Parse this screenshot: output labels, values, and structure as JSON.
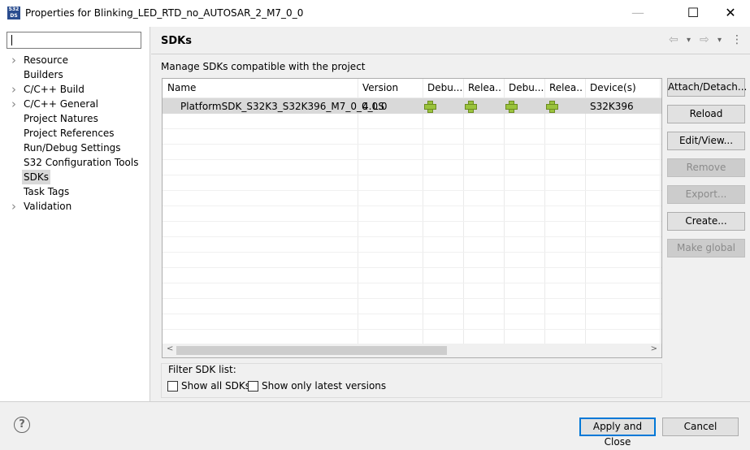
{
  "window": {
    "title": "Properties for Blinking_LED_RTD_no_AUTOSAR_2_M7_0_0",
    "icon_text": "S32 DS",
    "minimize": "—",
    "maximize": "☐",
    "close": "✕"
  },
  "sidebar": {
    "filter_value": "",
    "items": [
      {
        "label": "Resource",
        "expandable": true
      },
      {
        "label": "Builders",
        "expandable": false
      },
      {
        "label": "C/C++ Build",
        "expandable": true
      },
      {
        "label": "C/C++ General",
        "expandable": true
      },
      {
        "label": "Project Natures",
        "expandable": false
      },
      {
        "label": "Project References",
        "expandable": false
      },
      {
        "label": "Run/Debug Settings",
        "expandable": false
      },
      {
        "label": "S32 Configuration Tools",
        "expandable": false
      },
      {
        "label": "SDKs",
        "expandable": false,
        "selected": true
      },
      {
        "label": "Task Tags",
        "expandable": false
      },
      {
        "label": "Validation",
        "expandable": true
      }
    ]
  },
  "header": {
    "title": "SDKs",
    "back_icon": "⇦",
    "fwd_icon": "⇨",
    "dropdown": "▾",
    "menu": "⋮"
  },
  "main": {
    "description": "Manage SDKs compatible with the project",
    "columns": [
      "Name",
      "Version",
      "Debu...",
      "Relea...",
      "Debu...",
      "Relea...",
      "Device(s)"
    ],
    "rows": [
      {
        "name": "PlatformSDK_S32K3_S32K396_M7_0_0_LS",
        "version": "4.0.0",
        "debug1": true,
        "release1": true,
        "debug2": true,
        "release2": true,
        "devices": "S32K396"
      }
    ],
    "buttons": [
      {
        "label": "Attach/Detach...",
        "enabled": true
      },
      {
        "label": "Reload",
        "enabled": true
      },
      {
        "label": "Edit/View...",
        "enabled": true
      },
      {
        "label": "Remove",
        "enabled": false
      },
      {
        "label": "Export...",
        "enabled": false
      },
      {
        "label": "Create...",
        "enabled": true
      },
      {
        "label": "Make global",
        "enabled": false
      }
    ],
    "filter": {
      "label": "Filter SDK list:",
      "show_all": "Show all SDKs",
      "show_latest": "Show only latest versions"
    }
  },
  "footer": {
    "help": "?",
    "apply": "Apply and Close",
    "cancel": "Cancel"
  },
  "colors": {
    "selection": "#d9d9d9",
    "accent": "#0078d7",
    "plus": "#9ac33c"
  }
}
